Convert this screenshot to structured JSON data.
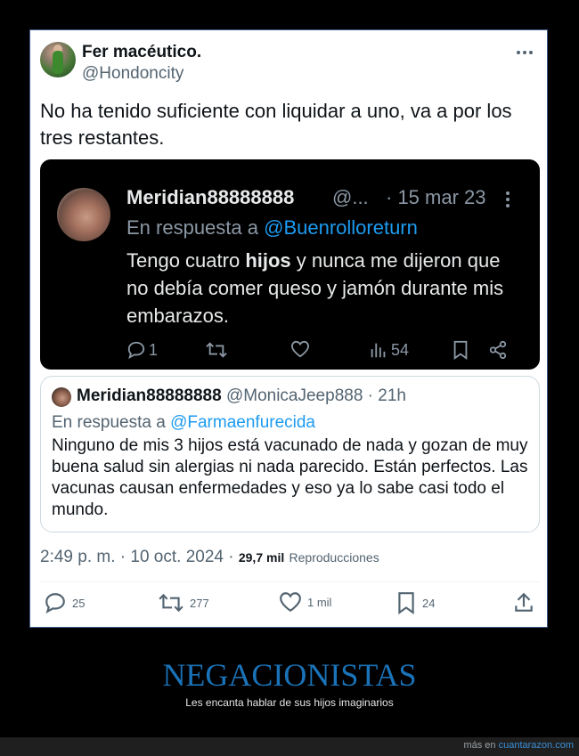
{
  "tweet": {
    "author_name": "Fer macéutico.",
    "author_handle": "@Hondoncity",
    "text": "No ha tenido suficiente con liquidar a uno, va a por los tres restantes.",
    "timestamp": "2:49 p. m. · 10 oct. 2024 ·",
    "views_count": "29,7 mil",
    "views_label": "Reproducciones",
    "actions": {
      "replies": "25",
      "retweets": "277",
      "likes": "1 mil",
      "bookmarks": "24"
    }
  },
  "embedded_screenshot": {
    "author_name": "Meridian88888888",
    "handle_truncated": "@...",
    "date": "· 15 mar 23",
    "reply_prefix": "En respuesta a",
    "reply_mention": "@Buenrolloreturn",
    "text_before": "Tengo cuatro ",
    "text_bold": "hijos",
    "text_after": " y nunca me dijeron que no debía comer queso y jamón durante mis embarazos.",
    "replies": "1",
    "views": "54"
  },
  "quoted_tweet": {
    "author_name": "Meridian88888888",
    "author_handle": "@MonicaJeep888 · 21h",
    "reply_prefix": "En respuesta a",
    "reply_mention": "@Farmaenfurecida",
    "text": "Ninguno de mis 3 hijos está vacunado de nada y gozan de muy buena salud sin alergias ni nada parecido.  Están perfectos. Las vacunas causan enfermedades y eso ya lo sabe casi todo el mundo."
  },
  "banner": {
    "title": "NEGACIONISTAS",
    "subtitle": "Les encanta hablar de sus hijos imaginarios"
  },
  "footer": {
    "prefix": "más en",
    "site": "cuantarazon.com"
  },
  "colors": {
    "accent_blue": "#1d9bf0",
    "banner_blue": "#1a73b8",
    "muted": "#536471"
  }
}
